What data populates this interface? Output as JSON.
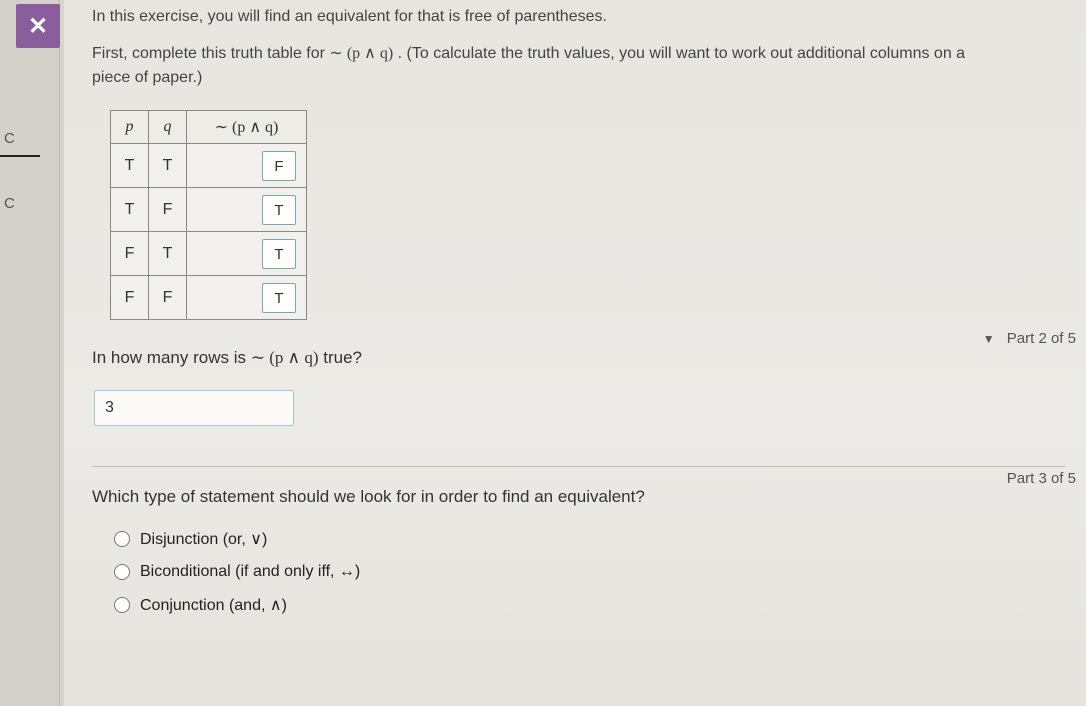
{
  "close_label": "✕",
  "side": {
    "c1": "C",
    "c2": "C"
  },
  "intro": "In this exercise, you will find an equivalent for that is free of parentheses.",
  "intro2_a": "First, complete this truth table for ",
  "intro2_expr": "∼ (p ∧ q)",
  "intro2_b": ". (To calculate the truth values, you will want to work out additional columns on a piece of paper.)",
  "table": {
    "h_p": "p",
    "h_q": "q",
    "h_expr": "∼ (p ∧ q)",
    "rows": [
      {
        "p": "T",
        "q": "T",
        "r": "F"
      },
      {
        "p": "T",
        "q": "F",
        "r": "T"
      },
      {
        "p": "F",
        "q": "T",
        "r": "T"
      },
      {
        "p": "F",
        "q": "F",
        "r": "T"
      }
    ]
  },
  "part2_marker": "▼",
  "part2_label": "Part 2 of 5",
  "q2_a": "In how many rows is ",
  "q2_expr": "∼ (p ∧ q)",
  "q2_b": " true?",
  "answer2": "3",
  "part3_label": "Part 3 of 5",
  "q3": "Which type of statement should we look for in order to find an equivalent?",
  "options": {
    "o1": "Disjunction (or, ∨)",
    "o2": "Biconditional (if and only iff, ↔)",
    "o3": "Conjunction (and, ∧)"
  }
}
